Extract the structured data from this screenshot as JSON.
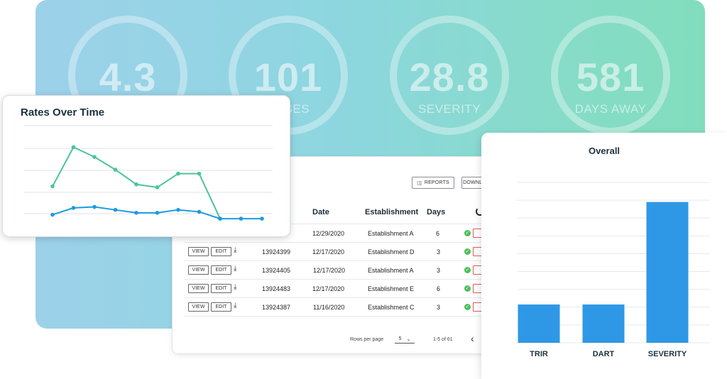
{
  "stats": [
    {
      "value": "4.3",
      "label": ""
    },
    {
      "value": "101",
      "label": "CASES"
    },
    {
      "value": "28.8",
      "label": "SEVERITY"
    },
    {
      "value": "581",
      "label": "DAYS AWAY"
    }
  ],
  "colors": {
    "teal": "#4cc49a",
    "blue": "#1b9ce0",
    "bar": "#2f98e6",
    "danger": "#e03b3b",
    "ok": "#4cbf5a"
  },
  "rates_card": {
    "title": "Rates Over Time"
  },
  "table": {
    "reports_label": "REPORTS",
    "downloads_label": "DOWNLOADS",
    "columns": {
      "date": "Date",
      "establishment": "Establishment",
      "days": "Days"
    },
    "view_label": "VIEW",
    "edit_label": "EDIT",
    "delete_label": "DELETE",
    "rows": [
      {
        "id": "",
        "date": "12/29/2020",
        "establishment": "Establishment A",
        "days": "6"
      },
      {
        "id": "13924399",
        "date": "12/17/2020",
        "establishment": "Establishment D",
        "days": "3"
      },
      {
        "id": "13924405",
        "date": "12/17/2020",
        "establishment": "Establishment A",
        "days": "3"
      },
      {
        "id": "13924483",
        "date": "12/17/2020",
        "establishment": "Establishment E",
        "days": "6"
      },
      {
        "id": "13924387",
        "date": "11/16/2020",
        "establishment": "Establishment C",
        "days": "3"
      }
    ],
    "footer": {
      "rows_per_page_label": "Rows per page",
      "rows_per_page_value": "5",
      "range": "1-5 of 61"
    }
  },
  "overall_card": {
    "title": "Overall"
  },
  "chart_data": [
    {
      "type": "line",
      "title": "Rates Over Time",
      "x": [
        1,
        2,
        3,
        4,
        5,
        6,
        7,
        8,
        9,
        10,
        11
      ],
      "series": [
        {
          "values": [
            3.3,
            7.3,
            6.3,
            5.0,
            3.5,
            3.2,
            4.6,
            4.6,
            0.0,
            null,
            null
          ]
        },
        {
          "values": [
            0.4,
            1.1,
            1.2,
            0.9,
            0.6,
            0.6,
            0.9,
            0.7,
            0.0,
            0.0,
            0.0
          ]
        }
      ],
      "ylim": [
        -0.5,
        9.5
      ],
      "grid": true
    },
    {
      "type": "bar",
      "title": "Overall",
      "categories": [
        "TRIR",
        "DART",
        "SEVERITY"
      ],
      "values": [
        4.3,
        4.3,
        15.8
      ],
      "ylim": [
        0,
        18
      ],
      "grid": true
    }
  ]
}
